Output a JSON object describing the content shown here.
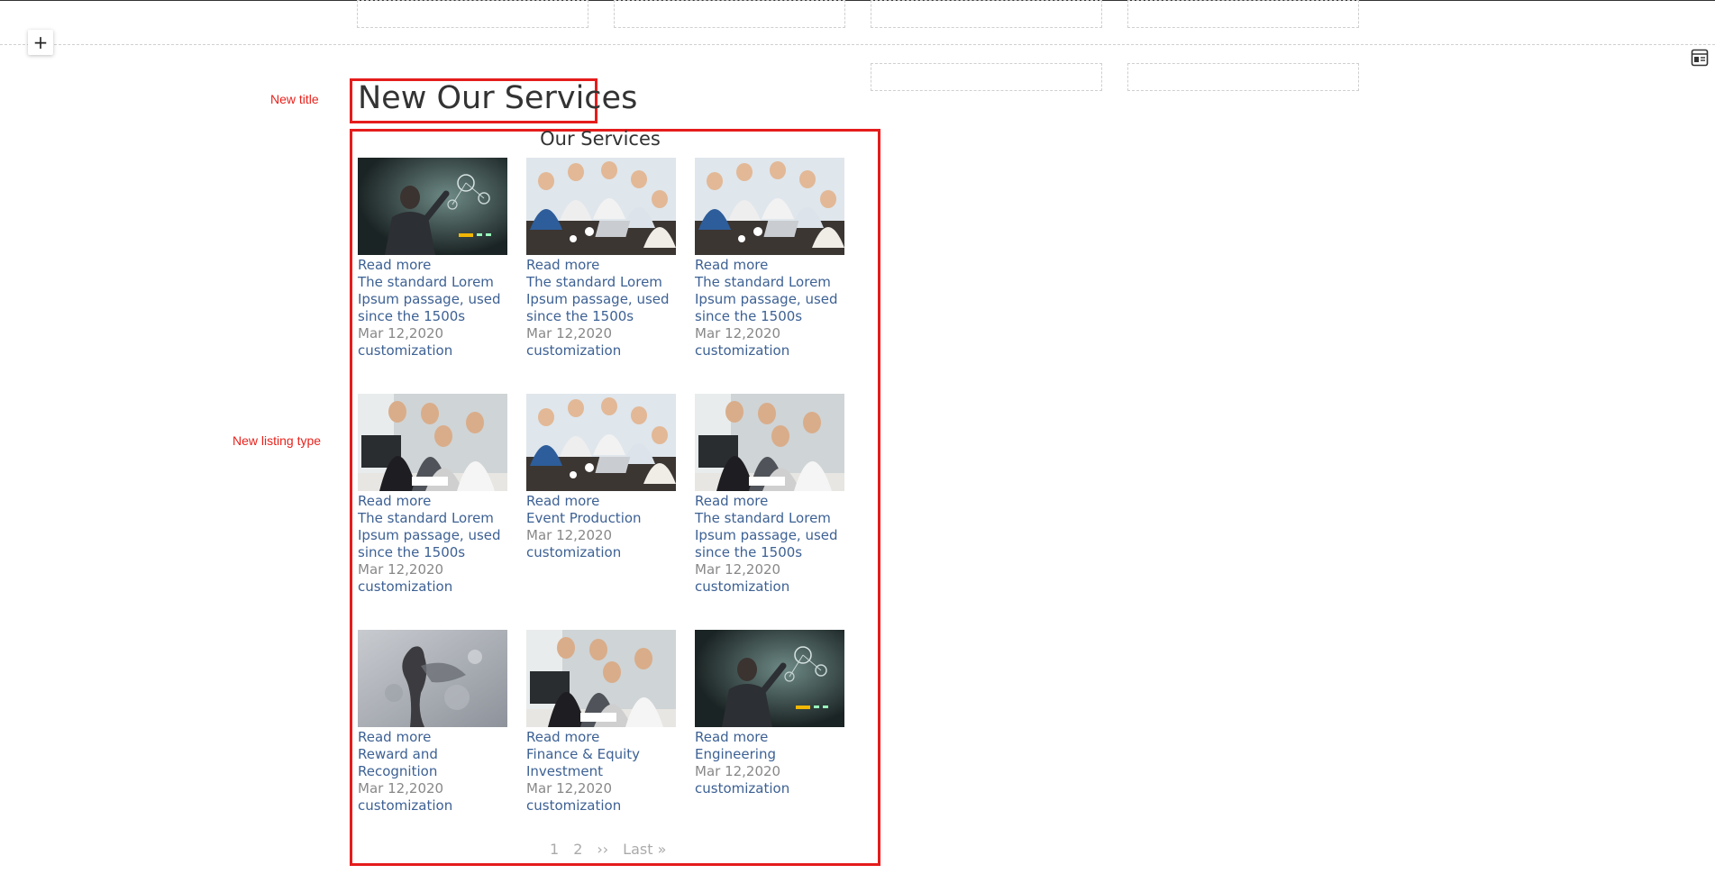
{
  "toolbar": {
    "add_symbol": "+"
  },
  "annotations": {
    "title_label": "New title",
    "listing_label": "New listing type"
  },
  "page": {
    "title": "New Our Services"
  },
  "listing": {
    "heading": "Our Services",
    "items": [
      {
        "image": "presentation-dark",
        "read_more": "Read more",
        "title": "The standard Lorem Ipsum passage, used since the 1500s",
        "date": "Mar 12,2020",
        "tag": "customization"
      },
      {
        "image": "team-meeting",
        "read_more": "Read more",
        "title": "The standard Lorem Ipsum passage, used since the 1500s",
        "date": "Mar 12,2020",
        "tag": "customization"
      },
      {
        "image": "team-meeting",
        "read_more": "Read more",
        "title": "The standard Lorem Ipsum passage, used since the 1500s",
        "date": "Mar 12,2020",
        "tag": "customization"
      },
      {
        "image": "office-laptop",
        "read_more": "Read more",
        "title": "The standard Lorem Ipsum passage, used since the 1500s",
        "date": "Mar 12,2020",
        "tag": "customization"
      },
      {
        "image": "team-meeting",
        "read_more": "Read more",
        "title": "Event Production",
        "date": "Mar 12,2020",
        "tag": "customization"
      },
      {
        "image": "office-laptop",
        "read_more": "Read more",
        "title": "The standard Lorem Ipsum passage, used since the 1500s",
        "date": "Mar 12,2020",
        "tag": "customization"
      },
      {
        "image": "splash-figure",
        "read_more": "Read more",
        "title": "Reward and Recognition",
        "date": "Mar 12,2020",
        "tag": "customization"
      },
      {
        "image": "office-laptop",
        "read_more": "Read more",
        "title": "Finance & Equity Investment",
        "date": "Mar 12,2020",
        "tag": "customization"
      },
      {
        "image": "presentation-dark",
        "read_more": "Read more",
        "title": "Engineering",
        "date": "Mar 12,2020",
        "tag": "customization"
      }
    ]
  },
  "pagination": {
    "page1": "1",
    "page2": "2",
    "next": "››",
    "last": "Last »"
  },
  "icons": {
    "add": "plus-icon",
    "side": "layout-panel-icon"
  }
}
